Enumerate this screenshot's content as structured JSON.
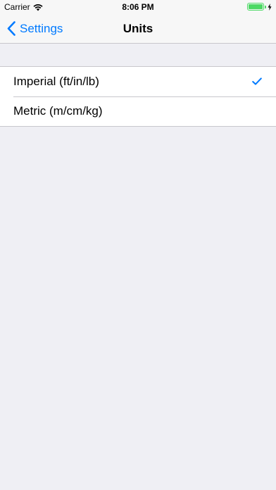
{
  "status_bar": {
    "carrier": "Carrier",
    "time": "8:06 PM",
    "battery_level": 1.0,
    "charging": true
  },
  "nav": {
    "back_label": "Settings",
    "title": "Units"
  },
  "options": [
    {
      "label": "Imperial (ft/in/lb)",
      "selected": true
    },
    {
      "label": "Metric (m/cm/kg)",
      "selected": false
    }
  ],
  "colors": {
    "accent": "#007aff",
    "battery": "#4cd964",
    "background": "#efeff4"
  }
}
